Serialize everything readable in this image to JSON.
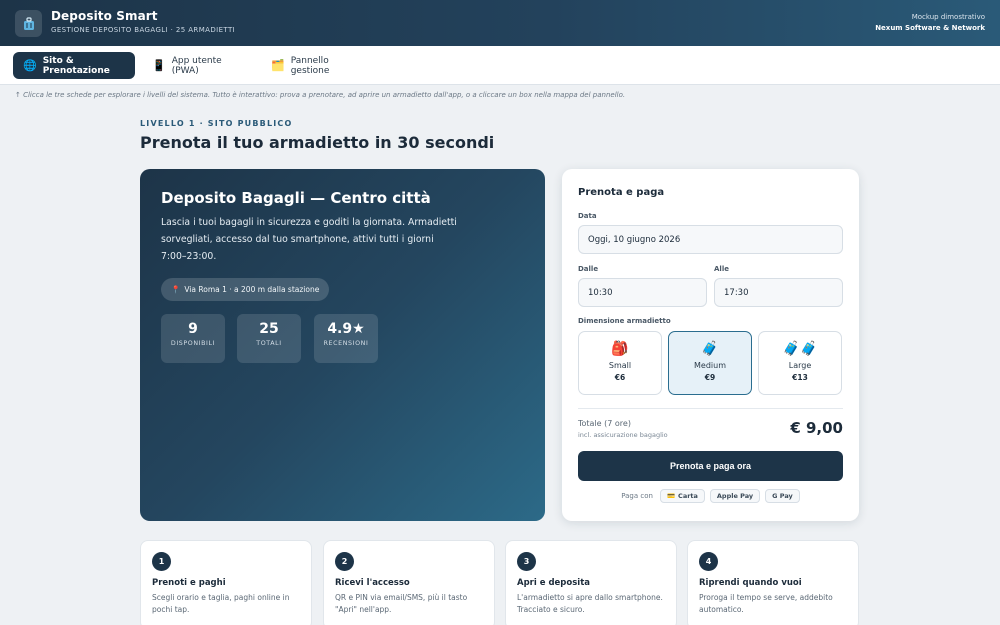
{
  "header": {
    "title": "Deposito Smart",
    "subtitle": "GESTIONE DEPOSITO BAGAGLI · 25 ARMADIETTI",
    "mockup_label": "Mockup dimostrativo",
    "company": "Nexum Software & Network",
    "logo_icon": "luggage-icon"
  },
  "tabs": [
    {
      "label": "Sito & Prenotazione",
      "icon": "🌐",
      "active": true
    },
    {
      "label": "App utente (PWA)",
      "icon": "📱",
      "active": false
    },
    {
      "label": "Pannello gestione",
      "icon": "🗂️",
      "active": false
    }
  ],
  "hint": "↑ Clicca le tre schede per esplorare i livelli del sistema. Tutto è interattivo: prova a prenotare, ad aprire un armadietto dall'app, o a cliccare un box nella mappa del pannello.",
  "section": {
    "level_label": "LIVELLO 1 · SITO PUBBLICO",
    "title": "Prenota il tuo armadietto in 30 secondi"
  },
  "hero": {
    "title": "Deposito Bagagli — Centro città",
    "description": "Lascia i tuoi bagagli in sicurezza e goditi la giornata. Armadietti sorvegliati, accesso dal tuo smartphone, attivi tutti i giorni 7:00–23:00.",
    "address_icon": "📍",
    "address": "Via Roma 1 · a 200 m dalla stazione",
    "stats": [
      {
        "value": "9",
        "label": "DISPONIBILI"
      },
      {
        "value": "25",
        "label": "TOTALI"
      },
      {
        "value": "4.9★",
        "label": "RECENSIONI"
      }
    ]
  },
  "booking": {
    "title": "Prenota e paga",
    "date_label": "Data",
    "date_value": "Oggi, 10 giugno 2026",
    "from_label": "Dalle",
    "from_value": "10:30",
    "to_label": "Alle",
    "to_value": "17:30",
    "size_label": "Dimensione armadietto",
    "sizes": [
      {
        "icon": "🎒",
        "name": "Small",
        "price": "€6",
        "selected": false
      },
      {
        "icon": "🧳",
        "name": "Medium",
        "price": "€9",
        "selected": true
      },
      {
        "icon": "🧳🧳",
        "name": "Large",
        "price": "€13",
        "selected": false
      }
    ],
    "total_label": "Totale (7 ore)",
    "total_note": "incl. assicurazione bagaglio",
    "total_amount": "€ 9,00",
    "pay_button": "Prenota e paga ora",
    "pay_with": "Paga con",
    "payment_methods": [
      {
        "icon": "💳",
        "label": "Carta"
      },
      {
        "icon": "",
        "label": "Apple Pay"
      },
      {
        "icon": "",
        "label": "G Pay"
      }
    ]
  },
  "steps": [
    {
      "num": "1",
      "title": "Prenoti e paghi",
      "desc": "Scegli orario e taglia, paghi online in pochi tap."
    },
    {
      "num": "2",
      "title": "Ricevi l'accesso",
      "desc": "QR e PIN via email/SMS, più il tasto \"Apri\" nell'app."
    },
    {
      "num": "3",
      "title": "Apri e deposita",
      "desc": "L'armadietto si apre dallo smartphone. Tracciato e sicuro."
    },
    {
      "num": "4",
      "title": "Riprendi quando vuoi",
      "desc": "Proroga il tempo se serve, addebito automatico."
    }
  ],
  "colors": {
    "primary": "#1d3448",
    "accent": "#2a5a78",
    "selected_bg": "#e6f1f8",
    "background": "#eef1f4"
  }
}
